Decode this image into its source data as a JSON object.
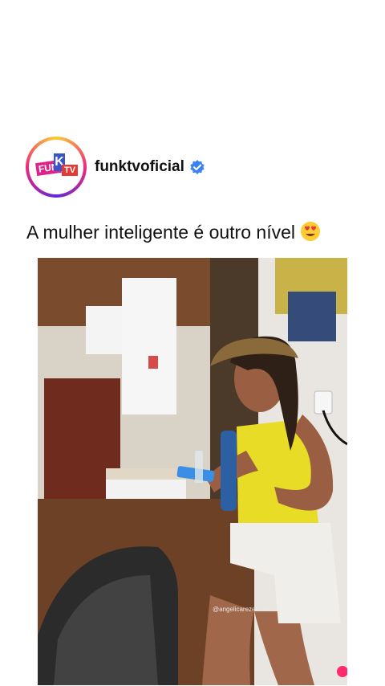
{
  "post": {
    "username": "funktvoficial",
    "caption": "A mulher inteligente é outro nível",
    "caption_emoji": "heart-eyes-emoji",
    "image_watermark": "@angelicarezende01",
    "avatar_logo": {
      "fun": "FUN",
      "k": "K",
      "tv": "TV"
    }
  },
  "colors": {
    "verified": "#3b82f6",
    "ring_start": "#f9ce34",
    "ring_mid": "#ee2a7b",
    "ring_end": "#6228d7"
  }
}
